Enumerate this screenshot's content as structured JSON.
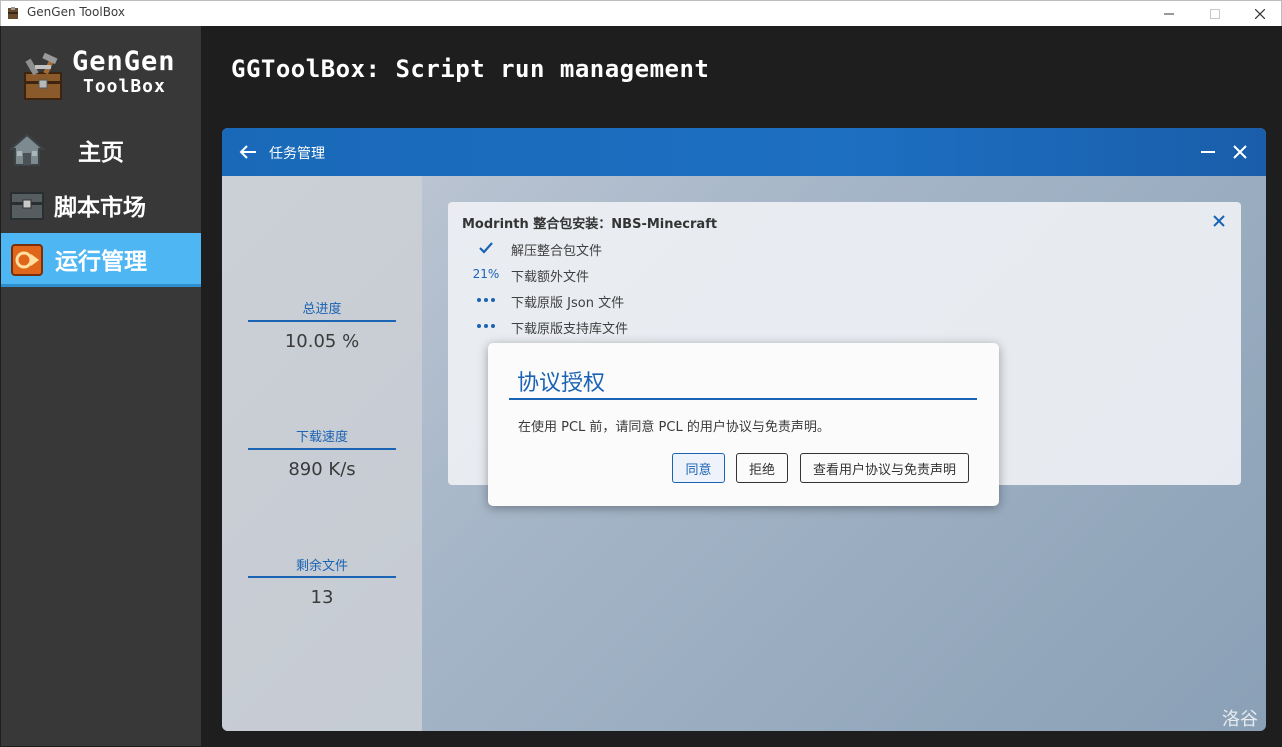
{
  "window": {
    "title": "GenGen ToolBox",
    "min": "—",
    "max": "☐",
    "close": "✕"
  },
  "sidebar": {
    "logo_line1": "GenGen",
    "logo_line2": "ToolBox",
    "items": [
      {
        "label": "主页",
        "icon": "house-icon"
      },
      {
        "label": "脚本市场",
        "icon": "chest-icon"
      },
      {
        "label": "运行管理",
        "icon": "gear-play-icon",
        "active": true
      }
    ]
  },
  "header": {
    "title": "GGToolBox: Script run management"
  },
  "launcher": {
    "title": "任务管理",
    "stats": [
      {
        "label": "总进度",
        "value": "10.05 %"
      },
      {
        "label": "下载速度",
        "value": "890 K/s"
      },
      {
        "label": "剩余文件",
        "value": "13"
      }
    ],
    "task": {
      "title": "Modrinth 整合包安装：NBS-Minecraft",
      "steps": [
        {
          "status": "done",
          "text": "解压整合包文件"
        },
        {
          "status": "progress",
          "percent": "21%",
          "text": "下载额外文件"
        },
        {
          "status": "pending",
          "text": "下载原版 Json 文件"
        },
        {
          "status": "pending",
          "text": "下载原版支持库文件"
        }
      ]
    },
    "watermark": "洛谷"
  },
  "modal": {
    "title": "协议授权",
    "text": "在使用 PCL 前，请同意 PCL 的用户协议与免责声明。",
    "buttons": {
      "agree": "同意",
      "reject": "拒绝",
      "view": "查看用户协议与免责声明"
    }
  },
  "colors": {
    "accent": "#1b63b3",
    "sidebar_active": "#4fb6f4",
    "sidebar_bg": "#383838",
    "bg": "#1e1e1e"
  }
}
